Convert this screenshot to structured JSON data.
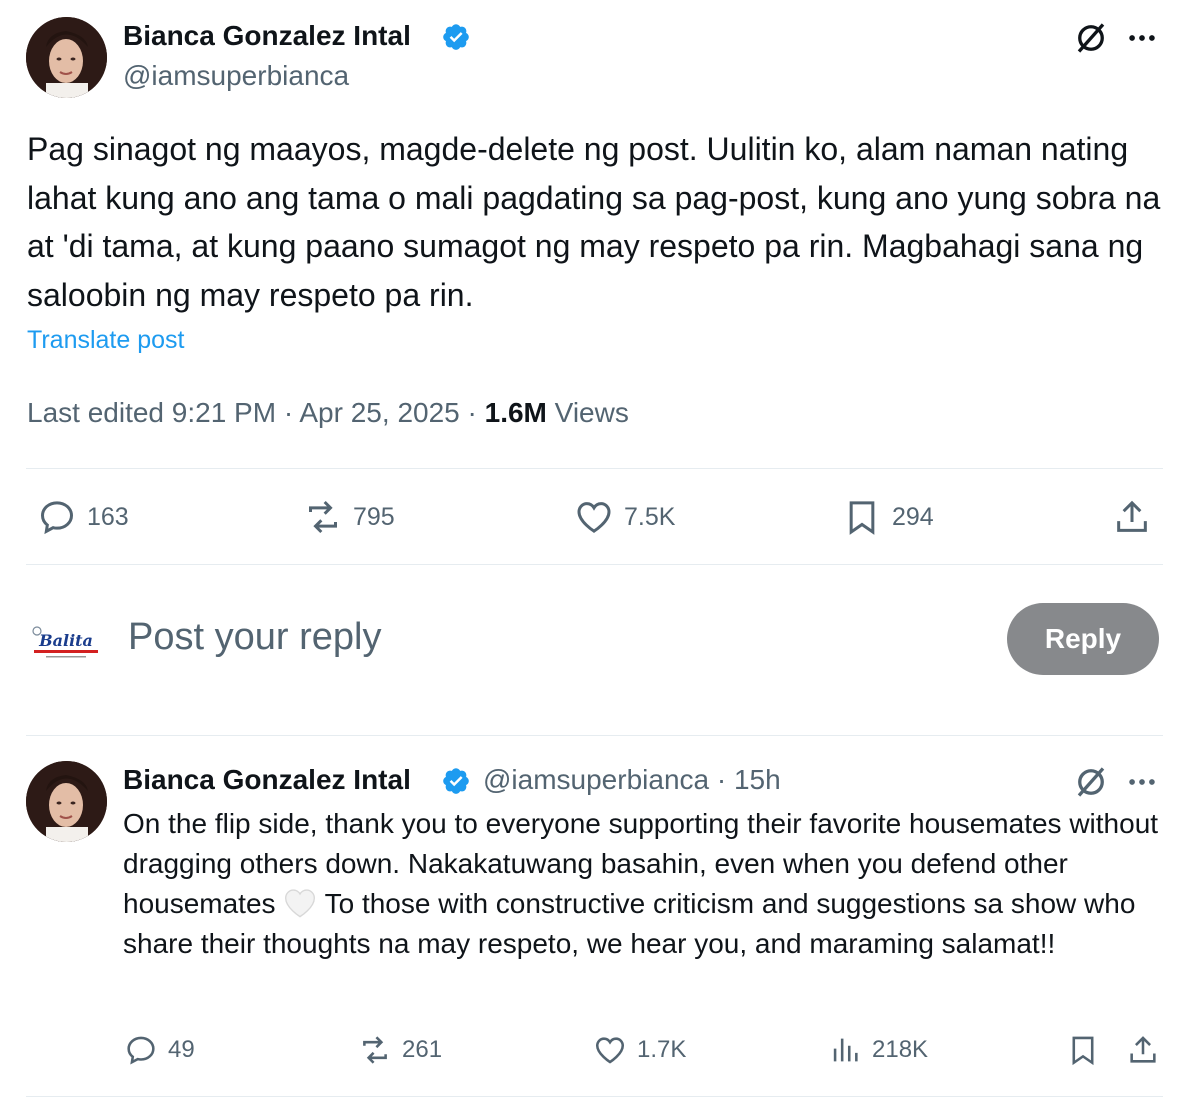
{
  "post": {
    "author_name": "Bianca Gonzalez Intal",
    "handle": "@iamsuperbianca",
    "text": "Pag sinagot ng maayos, magde-delete ng post. Uulitin ko, alam naman nating lahat kung ano ang tama o mali pagdating sa pag-post, kung ano yung sobra na at 'di tama, at kung paano sumagot ng may respeto pa rin. Magbahagi sana ng saloobin ng may respeto pa rin.",
    "translate_label": "Translate post",
    "edited_label": "Last edited 9:21 PM · Apr 25, 2025 · ",
    "views_count": "1.6M",
    "views_label": "Views",
    "stats": {
      "replies": "163",
      "reposts": "795",
      "likes": "7.5K",
      "bookmarks": "294"
    }
  },
  "reply_box": {
    "placeholder": "Post your reply",
    "button_label": "Reply",
    "logo_text": "Balita"
  },
  "reply": {
    "author_name": "Bianca Gonzalez Intal",
    "handle_time": "@iamsuperbianca · 15h",
    "text_part1": "On the flip side, thank you to everyone supporting their favorite housemates without dragging others down. Nakakatuwang basahin, even when you defend other housemates ",
    "text_part2": " To those with constructive criticism and suggestions sa show who share their thoughts na may respeto, we hear you, and maraming salamat!!",
    "stats": {
      "replies": "49",
      "reposts": "261",
      "likes": "1.7K",
      "views": "218K"
    }
  },
  "colors": {
    "accent": "#1d9bf0",
    "muted": "#536471",
    "reply_button": "#87898c"
  },
  "icons": [
    "verified-badge-icon",
    "grok-icon",
    "more-icon",
    "reply-icon",
    "repost-icon",
    "like-icon",
    "bookmark-icon",
    "share-icon",
    "views-icon",
    "white-heart-emoji"
  ]
}
